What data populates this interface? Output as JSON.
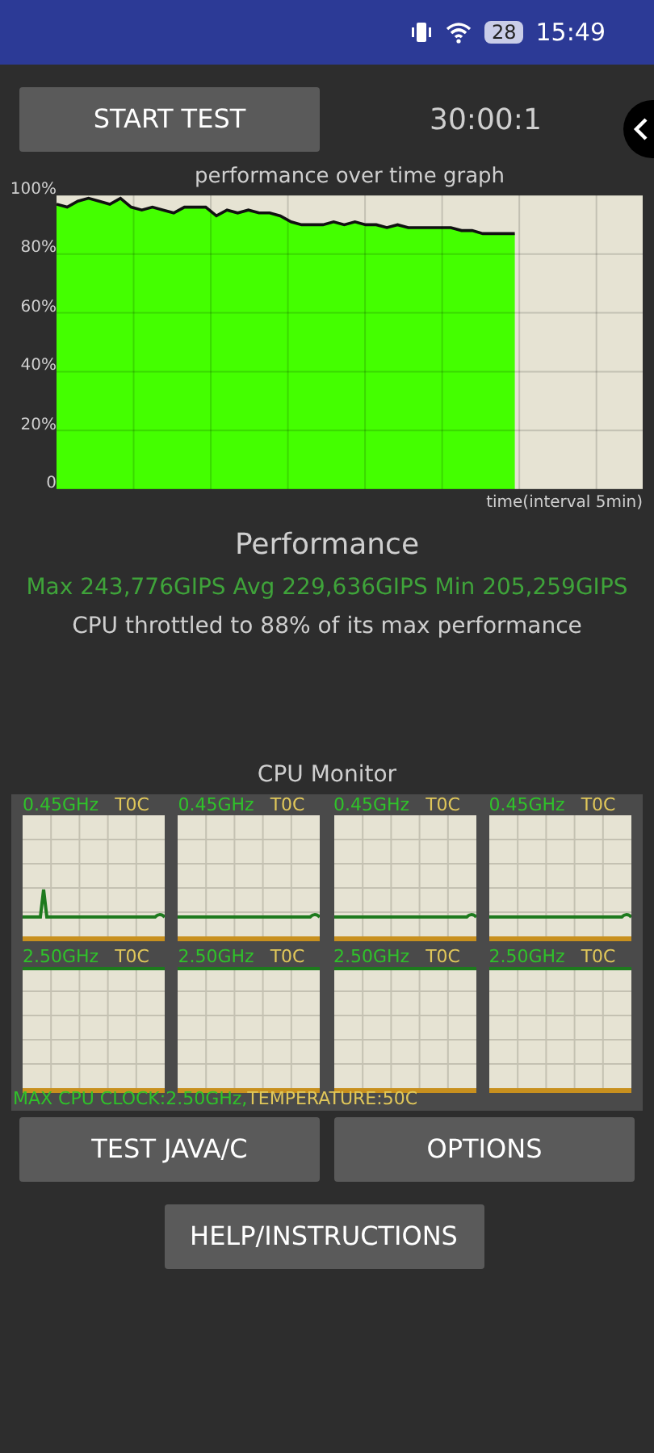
{
  "status_bar": {
    "battery": "28",
    "time": "15:49"
  },
  "start_button": "START TEST",
  "timer": "30:00:1",
  "performance_graph": {
    "chart_data": {
      "type": "area",
      "title": "performance over time graph",
      "xlabel": "time(interval 5min)",
      "grid": true,
      "ylim": [
        0,
        100
      ],
      "yticks": [
        {
          "value": 0,
          "label": "0"
        },
        {
          "value": 20,
          "label": "20%"
        },
        {
          "value": 40,
          "label": "40%"
        },
        {
          "value": 60,
          "label": "60%"
        },
        {
          "value": 80,
          "label": "80%"
        },
        {
          "value": 100,
          "label": "100%"
        }
      ],
      "series": [
        {
          "color": "#44ff00",
          "values": [
            97,
            96,
            98,
            99,
            98,
            97,
            99,
            96,
            95,
            96,
            95,
            94,
            96,
            96,
            96,
            93,
            95,
            94,
            95,
            94,
            94,
            93,
            91,
            90,
            90,
            90,
            91,
            90,
            91,
            90,
            90,
            89,
            90,
            89,
            89,
            89,
            89,
            89,
            88,
            88,
            87,
            87,
            87,
            87,
            null,
            null,
            null,
            null,
            null,
            null,
            null,
            null,
            null,
            null,
            null,
            null
          ]
        }
      ]
    }
  },
  "performance": {
    "title": "Performance",
    "stats": "Max 243,776GIPS Avg 229,636GIPS Min 205,259GIPS",
    "throttle": "CPU throttled to 88% of its max performance"
  },
  "cpu_monitor": {
    "title": "CPU Monitor",
    "cores": [
      {
        "clock": "0.45GHz",
        "temp": "T0C"
      },
      {
        "clock": "0.45GHz",
        "temp": "T0C"
      },
      {
        "clock": "0.45GHz",
        "temp": "T0C"
      },
      {
        "clock": "0.45GHz",
        "temp": "T0C"
      },
      {
        "clock": "2.50GHz",
        "temp": "T0C"
      },
      {
        "clock": "2.50GHz",
        "temp": "T0C"
      },
      {
        "clock": "2.50GHz",
        "temp": "T0C"
      },
      {
        "clock": "2.50GHz",
        "temp": "T0C"
      }
    ],
    "max_clock": "MAX CPU CLOCK:2.50GHz,",
    "temperature": "TEMPERATURE:50C"
  },
  "buttons": [
    "TEST JAVA/C",
    "OPTIONS",
    "HELP/INSTRUCTIONS"
  ]
}
